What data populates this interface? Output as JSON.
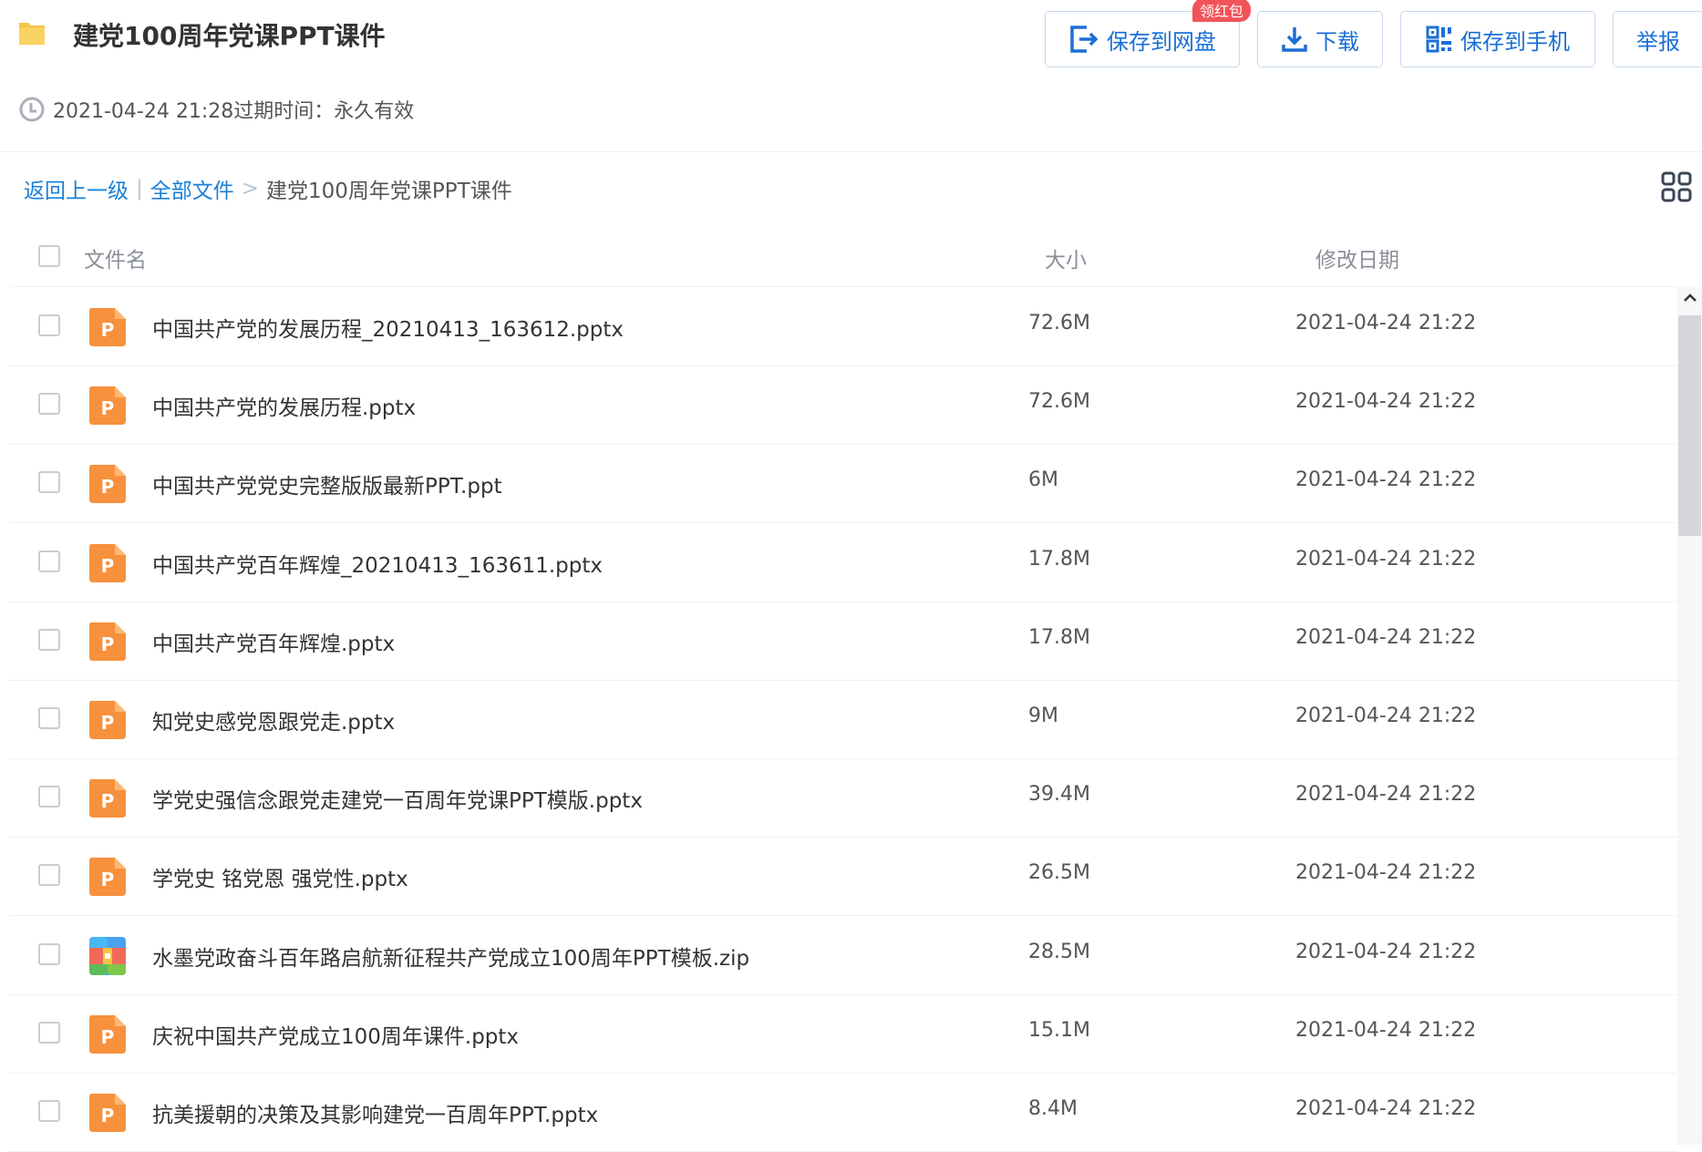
{
  "header": {
    "title": "建党100周年党课PPT课件",
    "meta": "2021-04-24 21:28过期时间：永久有效"
  },
  "actions": {
    "save_label": "保存到网盘",
    "badge": "领红包",
    "download_label": "下载",
    "save_mobile_label": "保存到手机",
    "report_label": "举报"
  },
  "breadcrumb": {
    "back": "返回上一级",
    "sep1": "|",
    "all": "全部文件",
    "sep2": ">",
    "current": "建党100周年党课PPT课件"
  },
  "table": {
    "headers": {
      "name": "文件名",
      "size": "大小",
      "date": "修改日期"
    },
    "rows": [
      {
        "name": "中国共产党的发展历程_20210413_163612.pptx",
        "size": "72.6M",
        "date": "2021-04-24 21:22",
        "type": "ppt"
      },
      {
        "name": "中国共产党的发展历程.pptx",
        "size": "72.6M",
        "date": "2021-04-24 21:22",
        "type": "ppt"
      },
      {
        "name": "中国共产党党史完整版版最新PPT.ppt",
        "size": "6M",
        "date": "2021-04-24 21:22",
        "type": "ppt"
      },
      {
        "name": "中国共产党百年辉煌_20210413_163611.pptx",
        "size": "17.8M",
        "date": "2021-04-24 21:22",
        "type": "ppt"
      },
      {
        "name": "中国共产党百年辉煌.pptx",
        "size": "17.8M",
        "date": "2021-04-24 21:22",
        "type": "ppt"
      },
      {
        "name": "知党史感党恩跟党走.pptx",
        "size": "9M",
        "date": "2021-04-24 21:22",
        "type": "ppt"
      },
      {
        "name": "学党史强信念跟党走建党一百周年党课PPT模版.pptx",
        "size": "39.4M",
        "date": "2021-04-24 21:22",
        "type": "ppt"
      },
      {
        "name": "学党史 铭党恩 强党性.pptx",
        "size": "26.5M",
        "date": "2021-04-24 21:22",
        "type": "ppt"
      },
      {
        "name": "水墨党政奋斗百年路启航新征程共产党成立100周年PPT模板.zip",
        "size": "28.5M",
        "date": "2021-04-24 21:22",
        "type": "zip"
      },
      {
        "name": "庆祝中国共产党成立100周年课件.pptx",
        "size": "15.1M",
        "date": "2021-04-24 21:22",
        "type": "ppt"
      },
      {
        "name": "抗美援朝的决策及其影响建党一百周年PPT.pptx",
        "size": "8.4M",
        "date": "2021-04-24 21:22",
        "type": "ppt"
      }
    ]
  },
  "icons": {
    "ppt_letter": "P",
    "ppt_color": "#f7913d",
    "accent": "#1a6fd6",
    "badge_color": "#f2535a"
  }
}
